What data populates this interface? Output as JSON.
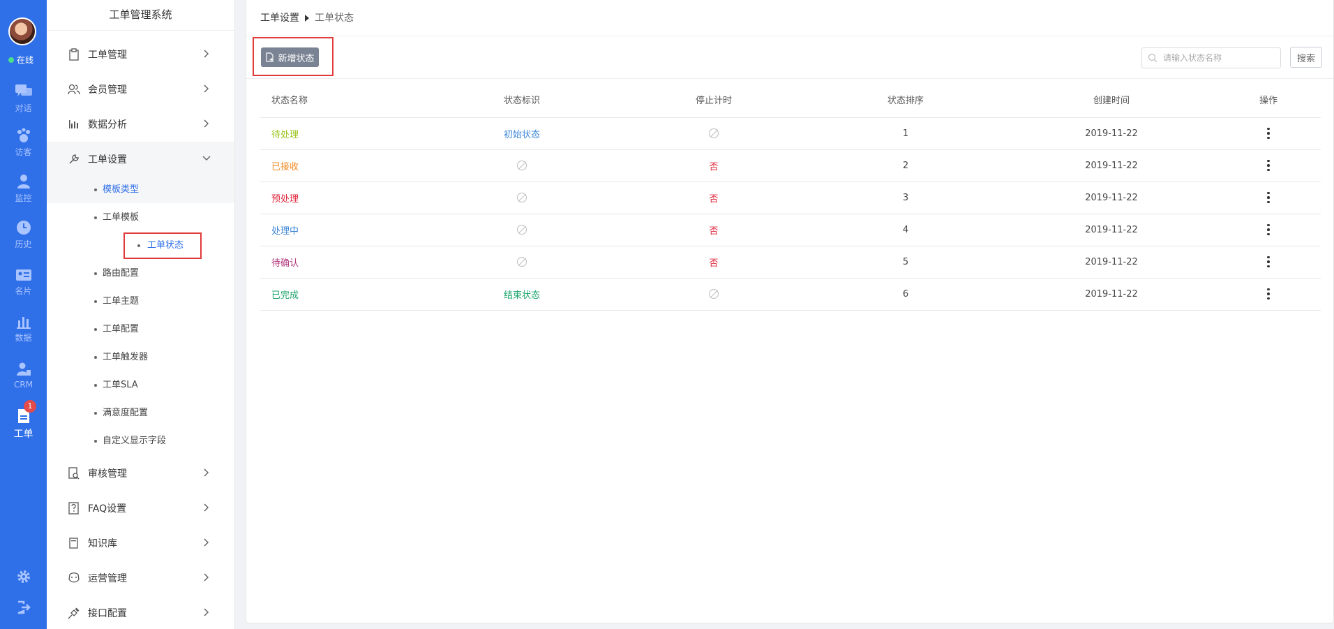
{
  "rail": {
    "status": "在线",
    "items": [
      {
        "label": "对话",
        "icon": "chat-icon"
      },
      {
        "label": "访客",
        "icon": "footprint-icon"
      },
      {
        "label": "监控",
        "icon": "monitor-user-icon"
      },
      {
        "label": "历史",
        "icon": "clock-icon"
      },
      {
        "label": "名片",
        "icon": "card-icon"
      },
      {
        "label": "数据",
        "icon": "bar-chart-icon"
      },
      {
        "label": "CRM",
        "icon": "crm-icon"
      },
      {
        "label": "工单",
        "icon": "ticket-icon",
        "badge": "1"
      }
    ],
    "accent": "#2f6fe8"
  },
  "sidebar": {
    "title": "工单管理系统",
    "menus": [
      {
        "label": "工单管理",
        "icon": "clipboard-icon"
      },
      {
        "label": "会员管理",
        "icon": "members-icon"
      },
      {
        "label": "数据分析",
        "icon": "bar-chart-icon"
      },
      {
        "label": "工单设置",
        "icon": "wrench-icon"
      }
    ],
    "sub_items": [
      "模板类型",
      "工单模板",
      "工单状态",
      "路由配置",
      "工单主题",
      "工单配置",
      "工单触发器",
      "工单SLA",
      "满意度配置",
      "自定义显示字段"
    ],
    "menus_bottom": [
      {
        "label": "审核管理",
        "icon": "review-icon"
      },
      {
        "label": "FAQ设置",
        "icon": "faq-icon"
      },
      {
        "label": "知识库",
        "icon": "book-icon"
      },
      {
        "label": "运营管理",
        "icon": "operations-icon"
      },
      {
        "label": "接口配置",
        "icon": "plug-icon"
      }
    ]
  },
  "breadcrumb": {
    "parent": "工单设置",
    "current": "工单状态"
  },
  "toolbar": {
    "add_label": "新增状态",
    "search_placeholder": "请输入状态名称",
    "search_label": "搜索"
  },
  "table": {
    "headers": [
      "状态名称",
      "状态标识",
      "停止计时",
      "状态排序",
      "创建时间",
      "操作"
    ],
    "rows": [
      {
        "name": "待处理",
        "name_color": "#9ac31c",
        "flag": "初始状态",
        "flag_color": "#3a86d6",
        "stop": "",
        "order": "1",
        "created": "2019-11-22"
      },
      {
        "name": "已接收",
        "name_color": "#f08a24",
        "flag": "",
        "flag_color": "",
        "stop": "否",
        "order": "2",
        "created": "2019-11-22"
      },
      {
        "name": "预处理",
        "name_color": "#e0253a",
        "flag": "",
        "flag_color": "",
        "stop": "否",
        "order": "3",
        "created": "2019-11-22"
      },
      {
        "name": "处理中",
        "name_color": "#3a86d6",
        "flag": "",
        "flag_color": "",
        "stop": "否",
        "order": "4",
        "created": "2019-11-22"
      },
      {
        "name": "待确认",
        "name_color": "#b0357a",
        "flag": "",
        "flag_color": "",
        "stop": "否",
        "order": "5",
        "created": "2019-11-22"
      },
      {
        "name": "已完成",
        "name_color": "#1aa36a",
        "flag": "结束状态",
        "flag_color": "#1aa36a",
        "stop": "",
        "order": "6",
        "created": "2019-11-22"
      }
    ],
    "no_color": "#e0253a"
  }
}
